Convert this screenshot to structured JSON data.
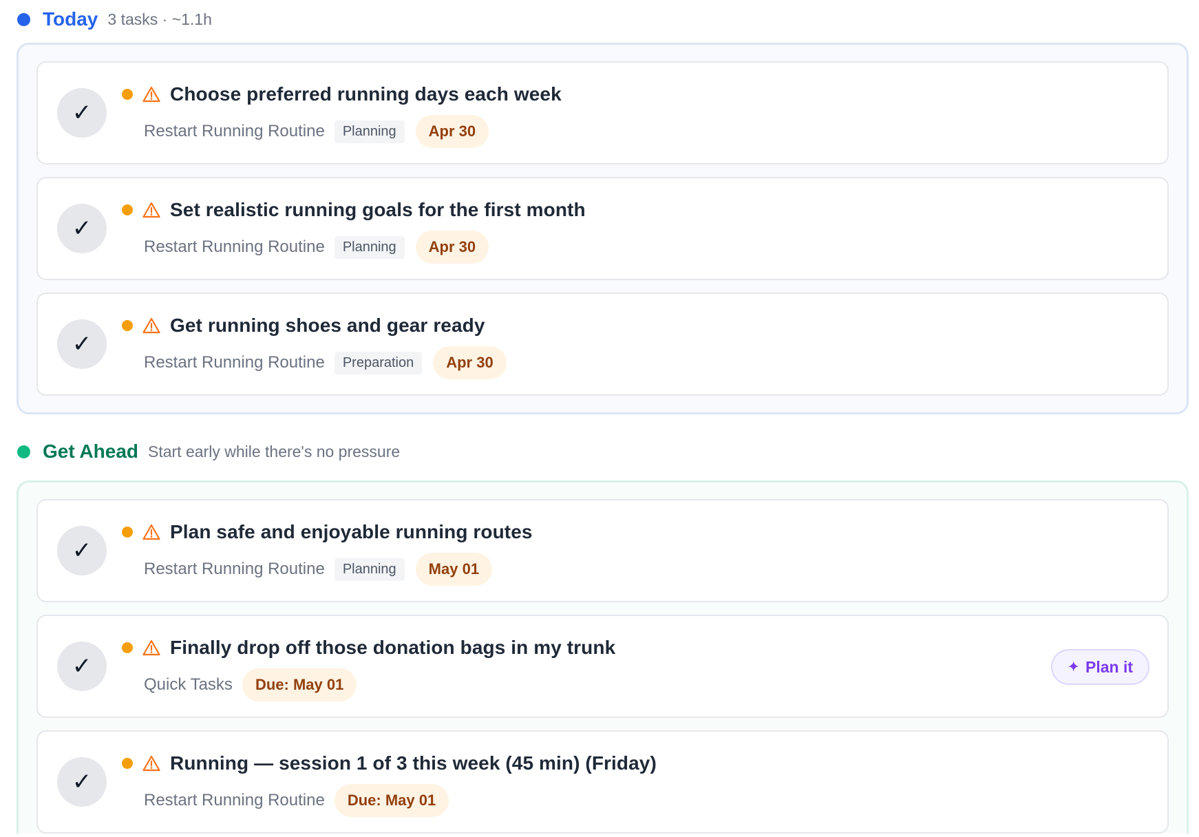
{
  "colors": {
    "today_accent": "#2563eb",
    "ahead_accent": "#10b981",
    "ahead_title": "#047857",
    "priority_dot": "#f59e0b",
    "warning": "#f97316",
    "date_text": "#92400e",
    "date_bg": "#fff3e3",
    "plan_accent": "#7c3aed"
  },
  "today": {
    "title": "Today",
    "meta": "3 tasks · ~1.1h",
    "tasks": [
      {
        "title": "Choose preferred running days each week",
        "project": "Restart Running Routine",
        "tag": "Planning",
        "date": "Apr 30"
      },
      {
        "title": "Set realistic running goals for the first month",
        "project": "Restart Running Routine",
        "tag": "Planning",
        "date": "Apr 30"
      },
      {
        "title": "Get running shoes and gear ready",
        "project": "Restart Running Routine",
        "tag": "Preparation",
        "date": "Apr 30"
      }
    ]
  },
  "ahead": {
    "title": "Get Ahead",
    "meta": "Start early while there's no pressure",
    "tasks": [
      {
        "title": "Plan safe and enjoyable running routes",
        "project": "Restart Running Routine",
        "tag": "Planning",
        "date": "May 01"
      },
      {
        "title": "Finally drop off those donation bags in my trunk",
        "project": "Quick Tasks",
        "date": "Due: May 01",
        "action_label": "Plan it"
      },
      {
        "title": "Running — session 1 of 3 this week (45 min) (Friday)",
        "project": "Restart Running Routine",
        "date": "Due: May 01"
      }
    ]
  },
  "icons": {
    "check": "✓",
    "warning": "warning-triangle-icon",
    "sparkle": "✦"
  }
}
